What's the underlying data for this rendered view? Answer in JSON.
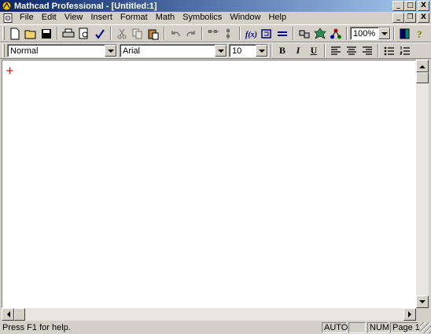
{
  "window": {
    "title": "Mathcad Professional - [Untitled:1]",
    "minimize": "_",
    "maximize": "□",
    "close": "X",
    "restore": "❐"
  },
  "menu": {
    "items": [
      "File",
      "Edit",
      "View",
      "Insert",
      "Format",
      "Math",
      "Symbolics",
      "Window",
      "Help"
    ]
  },
  "toolbar": {
    "zoom": "100%"
  },
  "format_bar": {
    "style": "Normal",
    "font": "Arial",
    "size": "10",
    "bold": "B",
    "italic": "I",
    "underline": "U"
  },
  "workspace": {
    "cursor": "+"
  },
  "status": {
    "help": "Press F1 for help.",
    "mode": "AUTO",
    "blank": "",
    "num": "NUM",
    "page": "Page 1"
  },
  "colors": {
    "title_start": "#0a246a",
    "title_end": "#a6caf0",
    "cursor": "#e00000"
  }
}
